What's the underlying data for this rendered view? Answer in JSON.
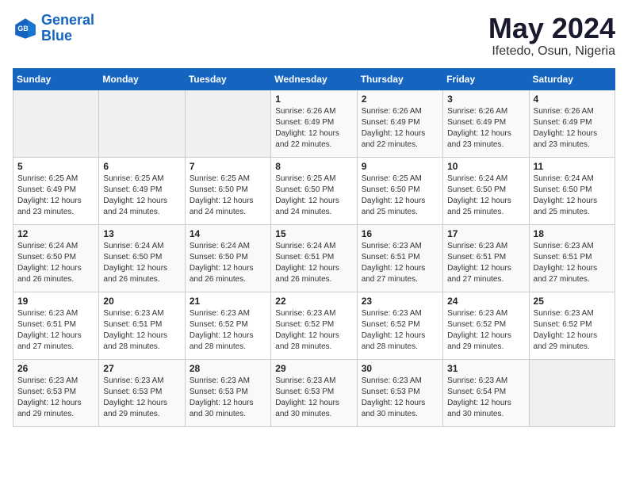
{
  "header": {
    "logo_line1": "General",
    "logo_line2": "Blue",
    "month_year": "May 2024",
    "location": "Ifetedo, Osun, Nigeria"
  },
  "days_of_week": [
    "Sunday",
    "Monday",
    "Tuesday",
    "Wednesday",
    "Thursday",
    "Friday",
    "Saturday"
  ],
  "weeks": [
    [
      {
        "day": "",
        "empty": true
      },
      {
        "day": "",
        "empty": true
      },
      {
        "day": "",
        "empty": true
      },
      {
        "day": "1",
        "sunrise": "6:26 AM",
        "sunset": "6:49 PM",
        "daylight": "12 hours and 22 minutes."
      },
      {
        "day": "2",
        "sunrise": "6:26 AM",
        "sunset": "6:49 PM",
        "daylight": "12 hours and 22 minutes."
      },
      {
        "day": "3",
        "sunrise": "6:26 AM",
        "sunset": "6:49 PM",
        "daylight": "12 hours and 23 minutes."
      },
      {
        "day": "4",
        "sunrise": "6:26 AM",
        "sunset": "6:49 PM",
        "daylight": "12 hours and 23 minutes."
      }
    ],
    [
      {
        "day": "5",
        "sunrise": "6:25 AM",
        "sunset": "6:49 PM",
        "daylight": "12 hours and 23 minutes."
      },
      {
        "day": "6",
        "sunrise": "6:25 AM",
        "sunset": "6:49 PM",
        "daylight": "12 hours and 24 minutes."
      },
      {
        "day": "7",
        "sunrise": "6:25 AM",
        "sunset": "6:50 PM",
        "daylight": "12 hours and 24 minutes."
      },
      {
        "day": "8",
        "sunrise": "6:25 AM",
        "sunset": "6:50 PM",
        "daylight": "12 hours and 24 minutes."
      },
      {
        "day": "9",
        "sunrise": "6:25 AM",
        "sunset": "6:50 PM",
        "daylight": "12 hours and 25 minutes."
      },
      {
        "day": "10",
        "sunrise": "6:24 AM",
        "sunset": "6:50 PM",
        "daylight": "12 hours and 25 minutes."
      },
      {
        "day": "11",
        "sunrise": "6:24 AM",
        "sunset": "6:50 PM",
        "daylight": "12 hours and 25 minutes."
      }
    ],
    [
      {
        "day": "12",
        "sunrise": "6:24 AM",
        "sunset": "6:50 PM",
        "daylight": "12 hours and 26 minutes."
      },
      {
        "day": "13",
        "sunrise": "6:24 AM",
        "sunset": "6:50 PM",
        "daylight": "12 hours and 26 minutes."
      },
      {
        "day": "14",
        "sunrise": "6:24 AM",
        "sunset": "6:50 PM",
        "daylight": "12 hours and 26 minutes."
      },
      {
        "day": "15",
        "sunrise": "6:24 AM",
        "sunset": "6:51 PM",
        "daylight": "12 hours and 26 minutes."
      },
      {
        "day": "16",
        "sunrise": "6:23 AM",
        "sunset": "6:51 PM",
        "daylight": "12 hours and 27 minutes."
      },
      {
        "day": "17",
        "sunrise": "6:23 AM",
        "sunset": "6:51 PM",
        "daylight": "12 hours and 27 minutes."
      },
      {
        "day": "18",
        "sunrise": "6:23 AM",
        "sunset": "6:51 PM",
        "daylight": "12 hours and 27 minutes."
      }
    ],
    [
      {
        "day": "19",
        "sunrise": "6:23 AM",
        "sunset": "6:51 PM",
        "daylight": "12 hours and 27 minutes."
      },
      {
        "day": "20",
        "sunrise": "6:23 AM",
        "sunset": "6:51 PM",
        "daylight": "12 hours and 28 minutes."
      },
      {
        "day": "21",
        "sunrise": "6:23 AM",
        "sunset": "6:52 PM",
        "daylight": "12 hours and 28 minutes."
      },
      {
        "day": "22",
        "sunrise": "6:23 AM",
        "sunset": "6:52 PM",
        "daylight": "12 hours and 28 minutes."
      },
      {
        "day": "23",
        "sunrise": "6:23 AM",
        "sunset": "6:52 PM",
        "daylight": "12 hours and 28 minutes."
      },
      {
        "day": "24",
        "sunrise": "6:23 AM",
        "sunset": "6:52 PM",
        "daylight": "12 hours and 29 minutes."
      },
      {
        "day": "25",
        "sunrise": "6:23 AM",
        "sunset": "6:52 PM",
        "daylight": "12 hours and 29 minutes."
      }
    ],
    [
      {
        "day": "26",
        "sunrise": "6:23 AM",
        "sunset": "6:53 PM",
        "daylight": "12 hours and 29 minutes."
      },
      {
        "day": "27",
        "sunrise": "6:23 AM",
        "sunset": "6:53 PM",
        "daylight": "12 hours and 29 minutes."
      },
      {
        "day": "28",
        "sunrise": "6:23 AM",
        "sunset": "6:53 PM",
        "daylight": "12 hours and 30 minutes."
      },
      {
        "day": "29",
        "sunrise": "6:23 AM",
        "sunset": "6:53 PM",
        "daylight": "12 hours and 30 minutes."
      },
      {
        "day": "30",
        "sunrise": "6:23 AM",
        "sunset": "6:53 PM",
        "daylight": "12 hours and 30 minutes."
      },
      {
        "day": "31",
        "sunrise": "6:23 AM",
        "sunset": "6:54 PM",
        "daylight": "12 hours and 30 minutes."
      },
      {
        "day": "",
        "empty": true
      }
    ]
  ],
  "labels": {
    "sunrise": "Sunrise:",
    "sunset": "Sunset:",
    "daylight": "Daylight:"
  }
}
